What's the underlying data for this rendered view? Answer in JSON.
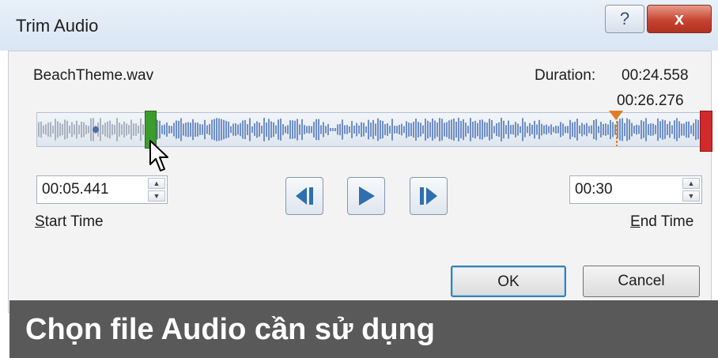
{
  "dialog": {
    "title": "Trim Audio",
    "help_label": "?",
    "close_label": "x",
    "file_name": "BeachTheme.wav",
    "duration_label": "Duration:",
    "duration_value": "00:24.558",
    "playhead_time": "00:26.276"
  },
  "start_time": {
    "value": "00:05.441",
    "label_first": "S",
    "label_rest": "tart Time"
  },
  "end_time": {
    "value": "00:30",
    "label_first": "E",
    "label_rest": "nd Time"
  },
  "buttons": {
    "ok": "OK",
    "cancel": "Cancel"
  },
  "caption": "Chọn file Audio cần sử dụng",
  "colors": {
    "trim_start_marker": "#3b9d2b",
    "trim_end_marker": "#d22a2a",
    "playhead_marker": "#e07e25",
    "waveform": "#6f8fc4",
    "caption_bg": "#595959"
  },
  "icons": [
    "help-icon",
    "close-icon",
    "previous-frame-icon",
    "play-icon",
    "next-frame-icon",
    "mouse-cursor-icon"
  ]
}
